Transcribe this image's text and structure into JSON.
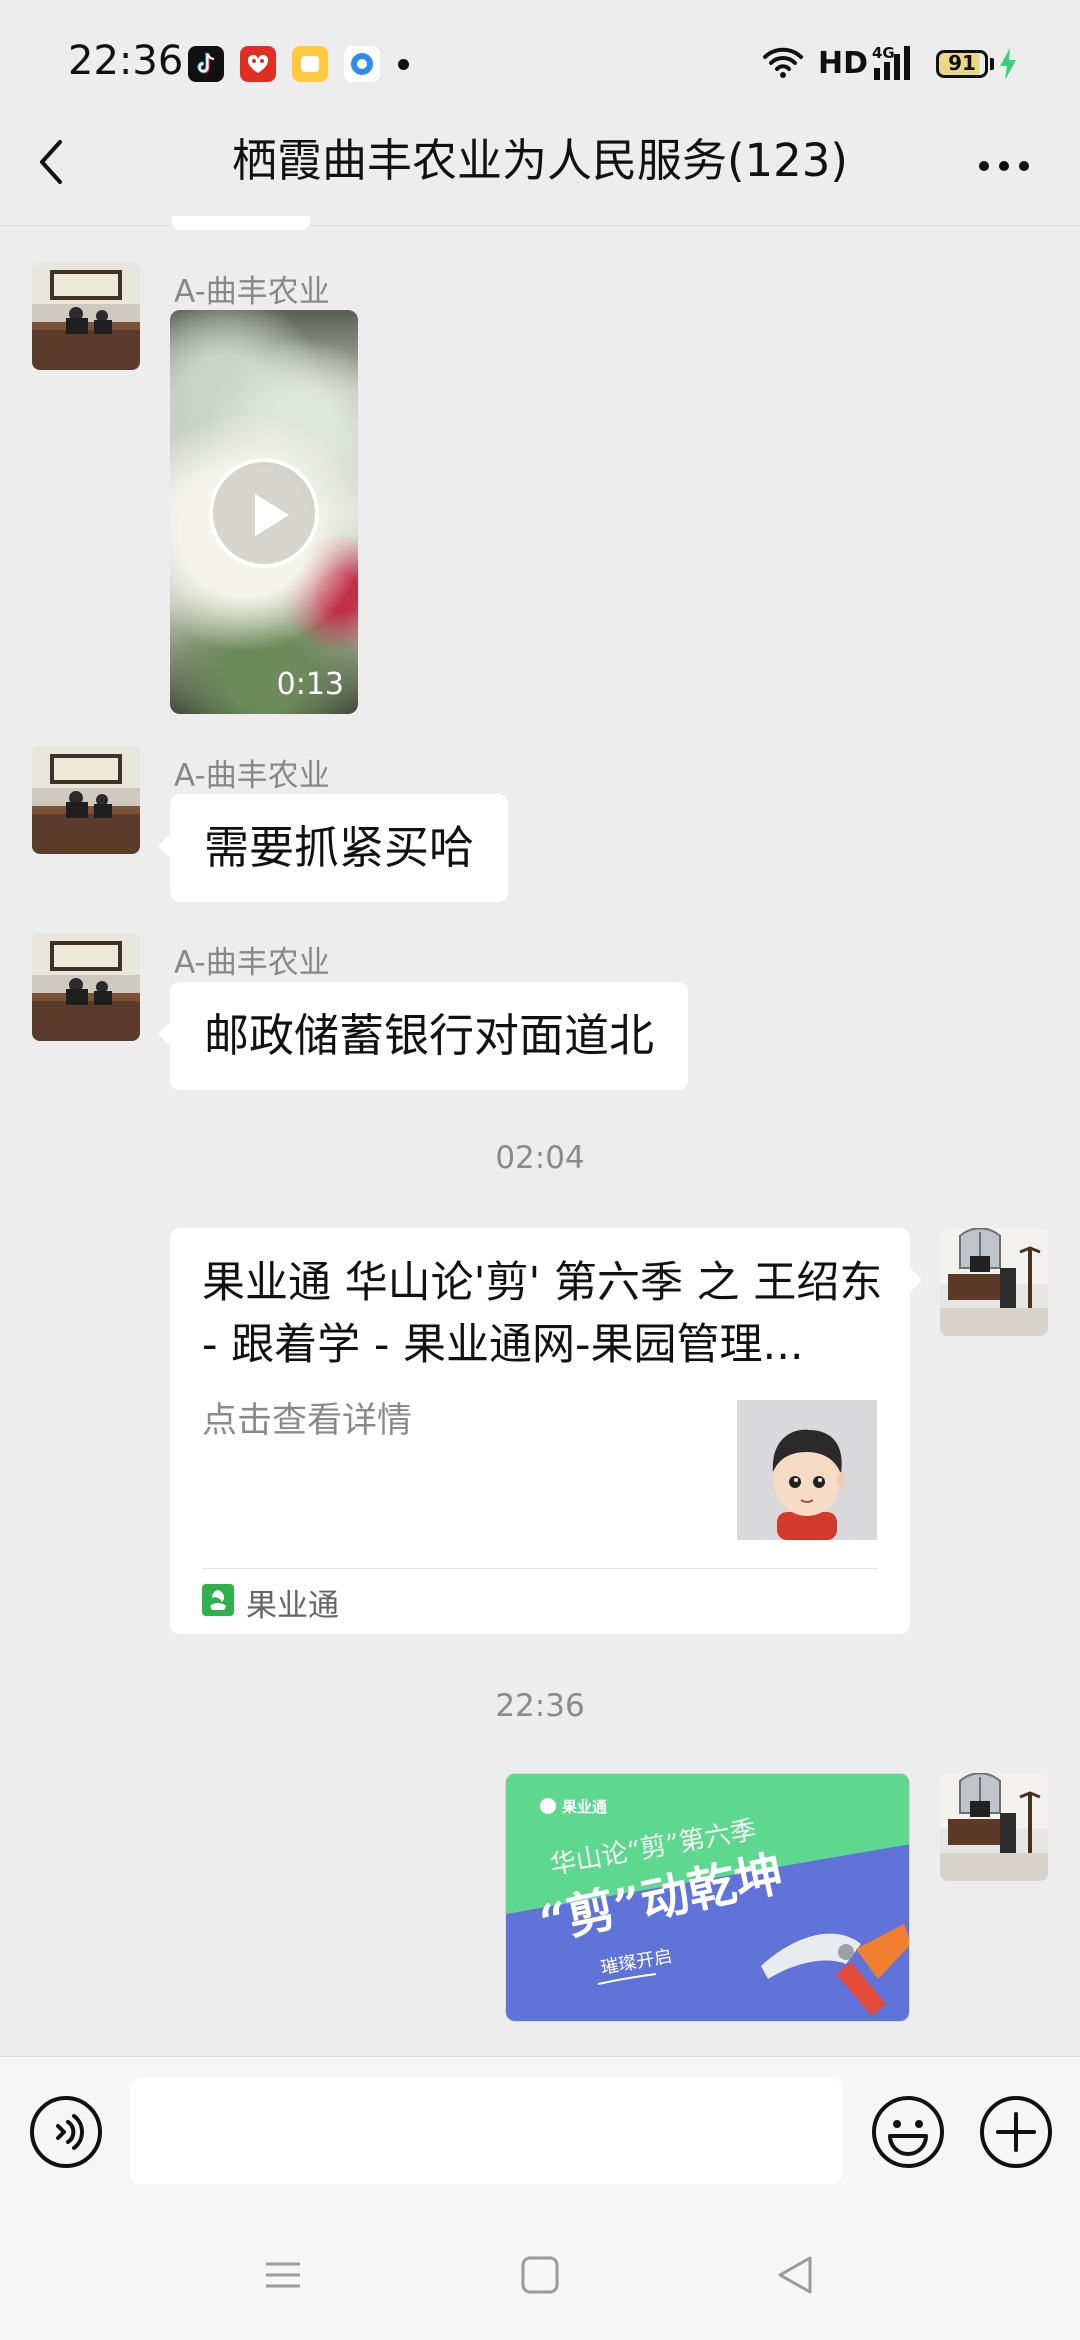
{
  "status_bar": {
    "time": "22:36",
    "network_label": "HD",
    "network_type": "4G",
    "battery_level": "91",
    "icons": [
      "douyin-icon",
      "pinduoduo-icon",
      "notes-icon",
      "browser-icon",
      "wifi-icon",
      "signal-icon",
      "battery-icon",
      "charging-icon"
    ]
  },
  "header": {
    "title": "栖霞曲丰农业为人民服务(123)",
    "back_icon": "chevron-left-icon",
    "more_icon": "more-dots-icon"
  },
  "messages": [
    {
      "type": "video",
      "sender": "A-曲丰农业",
      "duration": "0:13"
    },
    {
      "type": "text",
      "sender": "A-曲丰农业",
      "text": "需要抓紧买哈"
    },
    {
      "type": "text",
      "sender": "A-曲丰农业",
      "text": "邮政储蓄银行对面道北"
    },
    {
      "type": "time",
      "text": "02:04"
    },
    {
      "type": "link",
      "title": "果业通 华山论'剪' 第六季 之 王绍东 - 跟着学 - 果业通网-果园管理...",
      "description": "点击查看详情",
      "source": "果业通"
    },
    {
      "type": "time",
      "text": "22:36"
    },
    {
      "type": "image",
      "brand": "果业通",
      "headline": "华山论“剪”第六季",
      "slogan": "“剪”动乾坤",
      "tagline": "璀璨开启"
    }
  ],
  "input": {
    "value": "",
    "placeholder": "",
    "voice_icon": "voice-icon",
    "emoji_icon": "emoji-icon",
    "plus_icon": "plus-circle-icon"
  },
  "colors": {
    "background": "#ededed",
    "bubble": "#ffffff",
    "text": "#111111",
    "muted": "#888888",
    "image_green": "#5dd88e",
    "image_blue": "#5f73d8",
    "charging": "#3ccf7a"
  }
}
